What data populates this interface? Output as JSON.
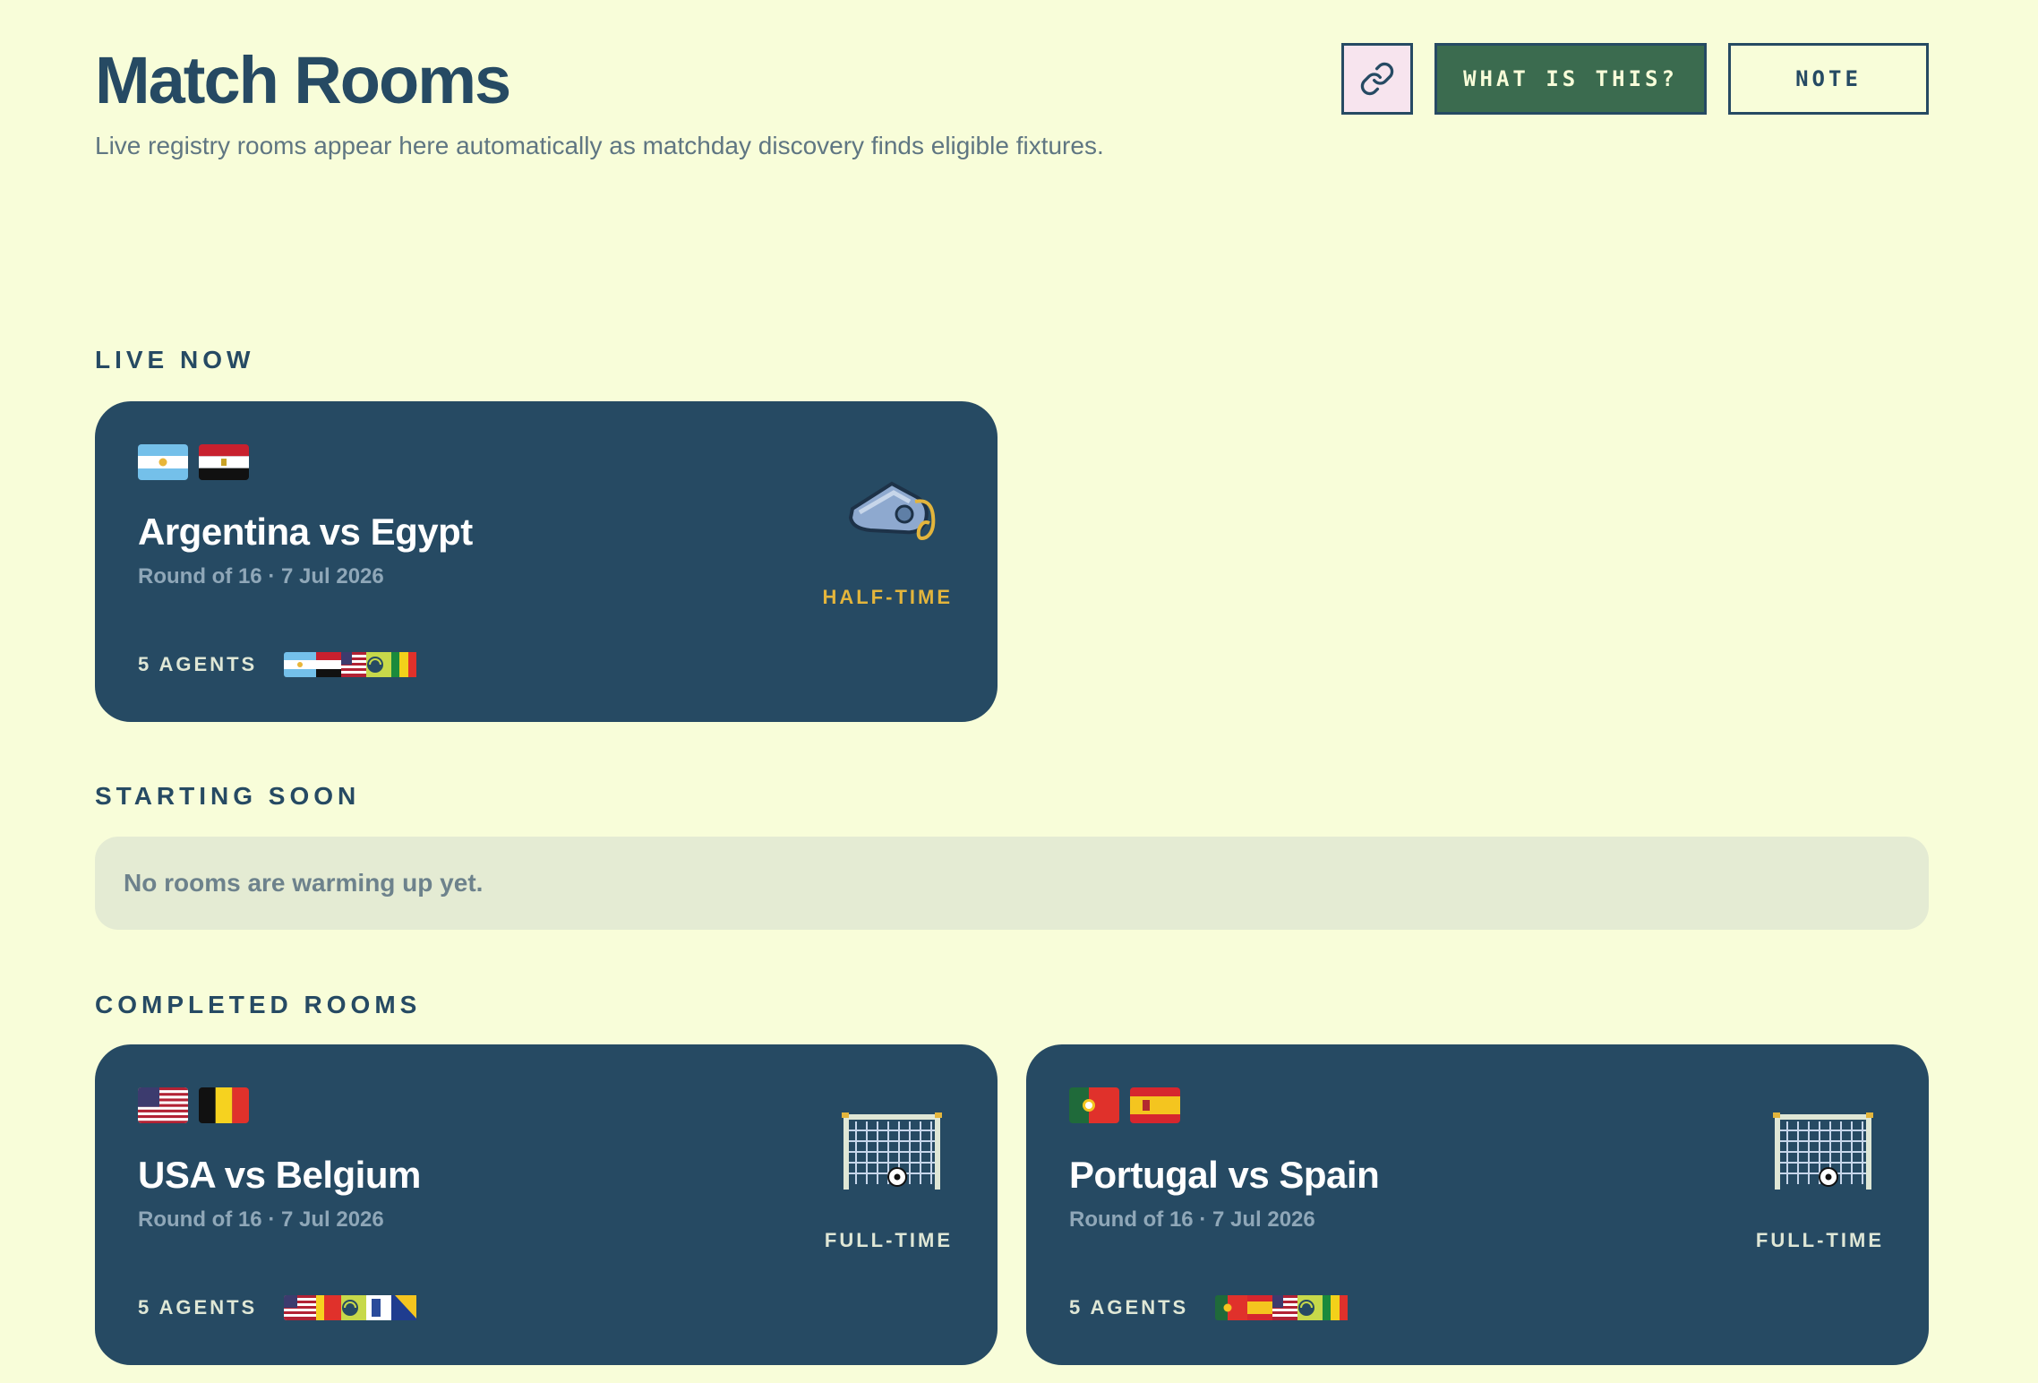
{
  "header": {
    "title": "Match Rooms",
    "subtitle": "Live registry rooms appear here automatically as matchday discovery finds eligible fixtures.",
    "link_icon": "link-icon",
    "what_label": "WHAT IS THIS?",
    "note_label": "NOTE"
  },
  "sections": {
    "live": "LIVE NOW",
    "soon": "STARTING SOON",
    "soon_empty": "No rooms are warming up yet.",
    "completed": "COMPLETED ROOMS"
  },
  "live_rooms": [
    {
      "title": "Argentina vs Egypt",
      "meta": "Round of 16 · 7 Jul 2026",
      "agents": "5 AGENTS",
      "status": "HALF-TIME",
      "status_icon": "whistle-icon",
      "status_color": "#e3b53c"
    }
  ],
  "completed_rooms": [
    {
      "title": "USA vs Belgium",
      "meta": "Round of 16 · 7 Jul 2026",
      "agents": "5 AGENTS",
      "status": "FULL-TIME",
      "status_icon": "goal-net-icon",
      "status_color": "#dfe7d6"
    },
    {
      "title": "Portugal vs Spain",
      "meta": "Round of 16 · 7 Jul 2026",
      "agents": "5 AGENTS",
      "status": "FULL-TIME",
      "status_icon": "goal-net-icon",
      "status_color": "#dfe7d6"
    }
  ]
}
